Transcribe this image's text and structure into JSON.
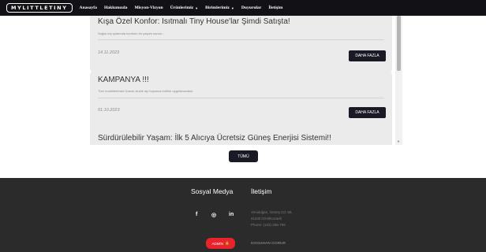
{
  "navbar": {
    "brand": "MYLITTLETINY",
    "links": [
      {
        "label": "Anasayfa",
        "dropdown": false
      },
      {
        "label": "Hakkımızda",
        "dropdown": false
      },
      {
        "label": "Misyon-Vizyon",
        "dropdown": false
      },
      {
        "label": "Ürünlerimiz",
        "dropdown": true
      },
      {
        "label": "Birimlerimiz",
        "dropdown": true
      },
      {
        "label": "Duyurular",
        "dropdown": false
      },
      {
        "label": "İletişim",
        "dropdown": false
      }
    ],
    "caret_glyph": "▼"
  },
  "announcements": [
    {
      "title": "Kışa Özel Konfor: Isıtmalı Tiny House'lar Şimdi Satışta!",
      "description": "Soğuk kış aylarında konforlu bir yaşam sunan...",
      "date": "14.11.2023",
      "button": "DAHA FAZLA"
    },
    {
      "title": "KAMPANYA !!!",
      "description": "Tüm modellerimize Kasım-Aralık ayı boyunca indirim uygulanacaktır.",
      "date": "01.10.2023",
      "button": "DAHA FAZLA"
    },
    {
      "title": "Sürdürülebilir Yaşam: İlk 5 Alıcıya Ücretsiz Güneş Enerjisi Sistemi!!",
      "description": "",
      "date": "",
      "button": ""
    }
  ],
  "all_button": "TÜMÜ",
  "footer": {
    "social_title": "Sosyal Medya",
    "contact_title": "İletişim",
    "social_icons": [
      {
        "name": "facebook-icon",
        "glyph": "f"
      },
      {
        "name": "instagram-icon",
        "glyph": "◎"
      },
      {
        "name": "linkedin-icon",
        "glyph": "in"
      }
    ],
    "contact_lines": [
      "Yenidoğan, Güneş Cd. 56,",
      "41100 İzmit/Kocaeli",
      "Phone: (123) 456-789"
    ],
    "admin_button": "ADMİN",
    "lock_glyph": "🔒",
    "signature": "DOGUHAN GORUR"
  }
}
